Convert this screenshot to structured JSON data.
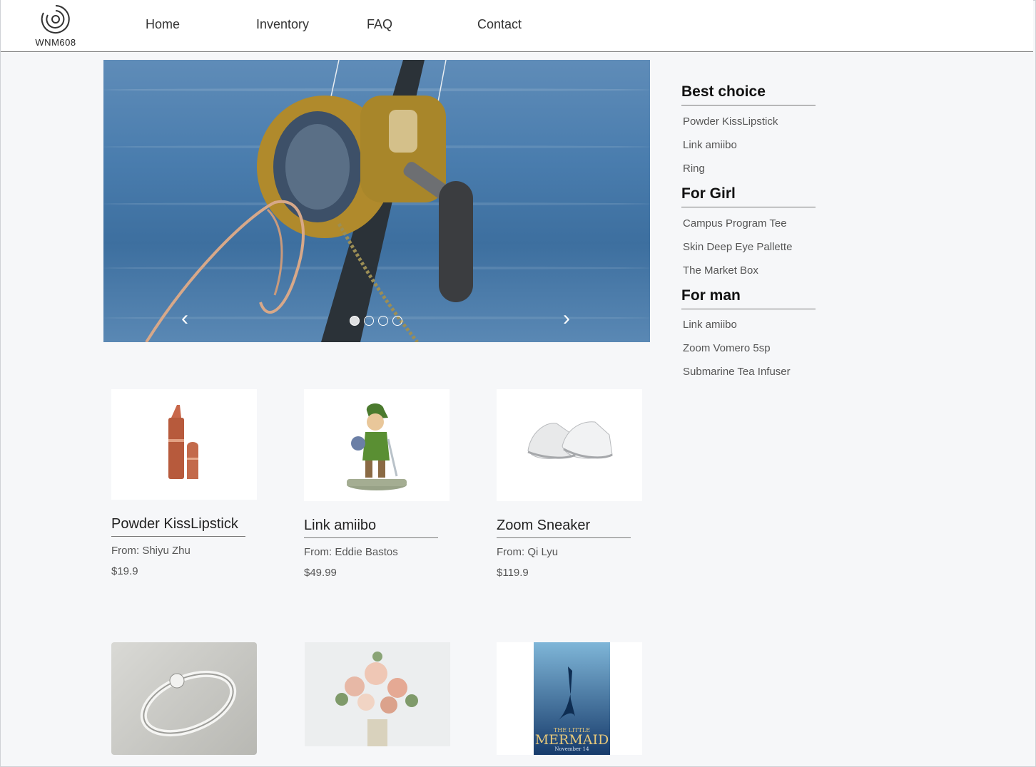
{
  "brand": {
    "logo_text": "WNM608"
  },
  "nav": {
    "items": [
      {
        "label": "Home"
      },
      {
        "label": "Inventory"
      },
      {
        "label": "FAQ"
      },
      {
        "label": "Contact"
      }
    ]
  },
  "carousel": {
    "prev_icon": "chevron-left-icon",
    "next_icon": "chevron-right-icon",
    "prev_glyph": "‹",
    "next_glyph": "›",
    "slide_count": 4,
    "active_index": 0
  },
  "sidebar": {
    "sections": [
      {
        "heading": "Best choice",
        "links": [
          "Powder KissLipstick",
          "Link amiibo",
          "Ring"
        ]
      },
      {
        "heading": "For Girl",
        "links": [
          "Campus Program Tee",
          "Skin Deep Eye Pallette",
          "The Market Box"
        ]
      },
      {
        "heading": "For man",
        "links": [
          "Link amiibo",
          "Zoom Vomero 5sp",
          "Submarine Tea Infuser"
        ]
      }
    ]
  },
  "products": [
    {
      "title": "Powder KissLipstick",
      "from": "From: Shiyu Zhu",
      "price": "$19.9"
    },
    {
      "title": "Link amiibo",
      "from": "From: Eddie Bastos",
      "price": "$49.99"
    },
    {
      "title": "Zoom Sneaker",
      "from": "From: Qi Lyu",
      "price": "$119.9"
    }
  ],
  "poster": {
    "title_line1": "THE LITTLE",
    "title_line2": "MERMAID",
    "date": "November 14"
  }
}
